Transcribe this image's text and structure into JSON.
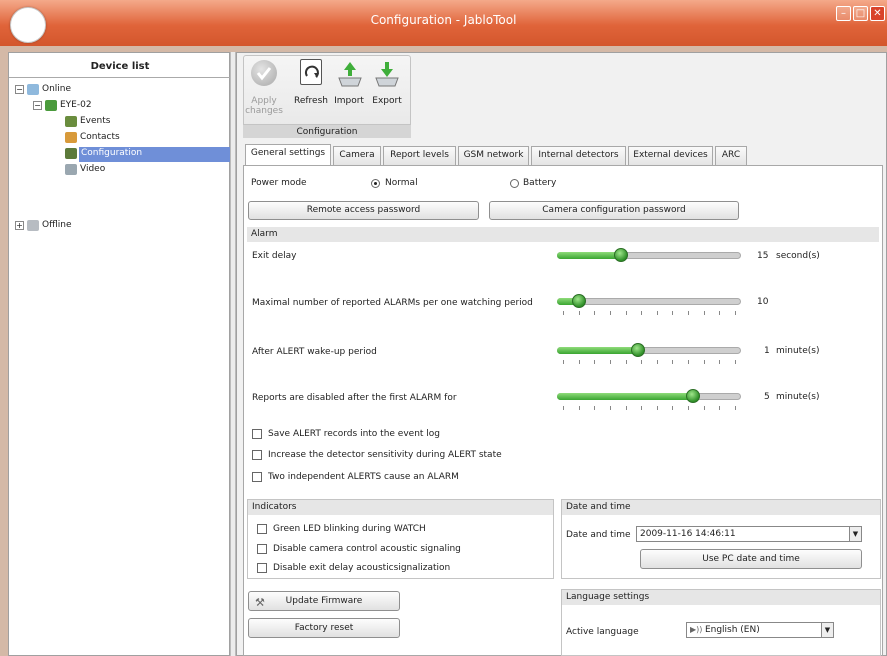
{
  "window": {
    "title": "Configuration - JabloTool"
  },
  "device_list": {
    "title": "Device list",
    "online_label": "Online",
    "device_label": "EYE-02",
    "children": [
      {
        "label": "Events",
        "icon": "events-icon"
      },
      {
        "label": "Contacts",
        "icon": "contacts-icon"
      },
      {
        "label": "Configuration",
        "icon": "configuration-icon",
        "selected": true
      },
      {
        "label": "Video",
        "icon": "video-icon"
      }
    ],
    "offline_label": "Offline",
    "selection_color": "#6f8fd8"
  },
  "toolbar": {
    "apply_label": "Apply changes",
    "refresh_label": "Refresh",
    "import_label": "Import",
    "export_label": "Export",
    "group_label": "Configuration"
  },
  "tabs": [
    "General settings",
    "Camera",
    "Report levels",
    "GSM network",
    "Internal detectors",
    "External devices",
    "ARC"
  ],
  "general": {
    "power_mode_label": "Power mode",
    "power_normal": "Normal",
    "power_battery": "Battery",
    "power_selected": "Normal",
    "remote_password_btn": "Remote access password",
    "camera_password_btn": "Camera configuration password"
  },
  "alarm": {
    "header": "Alarm",
    "sliders": [
      {
        "label": "Exit delay",
        "value": "15",
        "unit": "second(s)",
        "fraction": 0.35,
        "ticks": false
      },
      {
        "label": "Maximal number of reported ALARMs per one watching period",
        "value": "10",
        "unit": "",
        "fraction": 0.12,
        "ticks": true
      },
      {
        "label": "After ALERT wake-up period",
        "value": "1",
        "unit": "minute(s)",
        "fraction": 0.44,
        "ticks": true
      },
      {
        "label": "Reports are disabled after the first ALARM for",
        "value": "5",
        "unit": "minute(s)",
        "fraction": 0.74,
        "ticks": true
      }
    ],
    "checkboxes": [
      {
        "label": "Save ALERT records into the event log",
        "checked": false
      },
      {
        "label": "Increase the detector sensitivity during ALERT state",
        "checked": false
      },
      {
        "label": "Two independent ALERTS cause an ALARM",
        "checked": false
      }
    ]
  },
  "indicators": {
    "header": "Indicators",
    "checkboxes": [
      {
        "label": "Green LED blinking during WATCH",
        "checked": false
      },
      {
        "label": "Disable camera control acoustic signaling",
        "checked": false
      },
      {
        "label": "Disable exit delay acousticsignalization",
        "checked": false
      }
    ]
  },
  "datetime": {
    "header": "Date and time",
    "label": "Date and time",
    "value": "2009-11-16 14:46:11",
    "use_pc_btn": "Use PC date and time"
  },
  "firmware": {
    "update_btn": "Update Firmware",
    "factory_reset_btn": "Factory reset"
  },
  "language": {
    "header": "Language settings",
    "label": "Active language",
    "value": "English (EN)"
  },
  "colors": {
    "titlebar": "#e0643a",
    "slider_green": "#3aa531"
  }
}
